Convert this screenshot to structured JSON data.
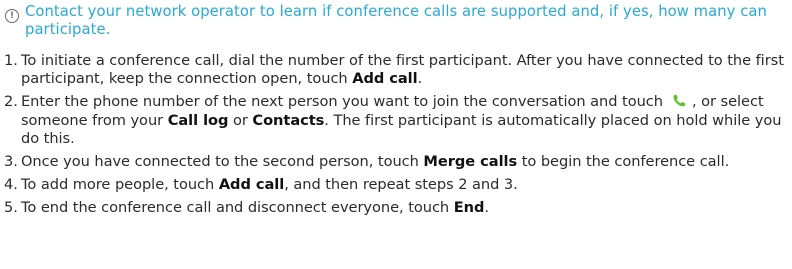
{
  "note": {
    "icon": "info-alert-icon",
    "icon_glyph": "!",
    "text": "Contact your network operator to learn if conference calls are supported and, if yes, how many can participate."
  },
  "steps": [
    {
      "number": "1.",
      "text_a": "To initiate a conference call, dial the number of the first participant. After you have connected to the first participant, keep the connection open, touch ",
      "bold_a": "Add call",
      "text_b": "."
    },
    {
      "number": "2.",
      "text_a": "Enter the phone number of the next person you want to join the conversation and touch",
      "icon": "green-phone-icon",
      "text_b": ", or select someone from your ",
      "bold_a": "Call log",
      "text_c": " or ",
      "bold_b": "Contacts",
      "text_d": ". The first participant is automatically placed on hold while you do this."
    },
    {
      "number": "3.",
      "text_a": "Once you have connected to the second person, touch ",
      "bold_a": "Merge calls",
      "text_b": " to begin the conference call."
    },
    {
      "number": "4.",
      "text_a": "To add more people, touch ",
      "bold_a": "Add call",
      "text_b": ", and then repeat steps 2 and 3."
    },
    {
      "number": "5.",
      "text_a": "To end the conference call and disconnect everyone, touch ",
      "bold_a": "End",
      "text_b": "."
    }
  ],
  "colors": {
    "note_text": "#29a9d6",
    "body_text": "#2b2b2b",
    "phone_icon": "#5cc22b"
  }
}
